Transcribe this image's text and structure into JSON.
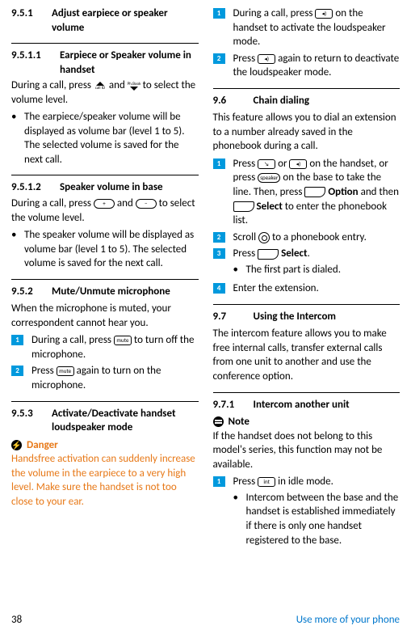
{
  "footer": {
    "page": "38",
    "chapter": "Use more of your phone"
  },
  "left": {
    "s951": {
      "num": "9.5.1",
      "title": "Adjust earpiece or speaker volume"
    },
    "s9511": {
      "num": "9.5.1.1",
      "title": "Earpiece or Speaker volume in handset",
      "p1a": "During a call, press ",
      "p1b": " and ",
      "p1c": " to select the volume level.",
      "bul": "The earpiece/speaker volume will be displayed as volume bar (level 1 to 5). The selected volume is saved for the next call."
    },
    "s9512": {
      "num": "9.5.1.2",
      "title": "Speaker volume in base",
      "p1a": "During a call, press ",
      "p1b": " and ",
      "p1c": " to select the volume level.",
      "keyPlus": "+",
      "keyMinus": "−",
      "bul": "The speaker volume will be displayed as volume bar (level 1 to 5). The selected volume is saved for the next call."
    },
    "s952": {
      "num": "9.5.2",
      "title": "Mute/Unmute microphone",
      "intro": "When the microphone is muted, your correspondent cannot hear you.",
      "step1a": "During a call, press ",
      "step1b": " to turn off the microphone.",
      "step2a": "Press ",
      "step2b": " again to turn on the microphone.",
      "keyMute": "mute"
    },
    "s953": {
      "num": "9.5.3",
      "title": "Activate/Deactivate handset loudspeaker mode",
      "dangerLabel": "Danger",
      "dangerText": "Handsfree activation can suddenly increase the volume in the earpiece to a very high level. Make sure the handset is not too close to your ear."
    }
  },
  "right": {
    "cont": {
      "step1a": "During a call, press ",
      "step1b": " on the handset to activate the loudspeaker mode.",
      "step2a": "Press ",
      "step2b": " again to return to deactivate the loudspeaker mode.",
      "keySpk": "◂)"
    },
    "s96": {
      "num": "9.6",
      "title": "Chain dialing",
      "intro": "This feature allows you to dial an extension to a number already saved in the phonebook during a call.",
      "step1a": "Press ",
      "step1b": " or ",
      "step1c": " on the handset, or press ",
      "step1d": " on the base to take the line. Then, press ",
      "step1Option": "Option",
      "step1e": " and then ",
      "step1Select": "Select",
      "step1f": " to enter the phonebook list.",
      "keyTalk": "↘",
      "keyHFree": "◂)",
      "keySpeaker": "speaker",
      "step2a": "Scroll ",
      "step2b": " to a phonebook entry.",
      "step3a": "Press ",
      "step3Select": "Select",
      "step3b": ".",
      "step3sub": "The first part is dialed.",
      "step4": "Enter the extension."
    },
    "s97": {
      "num": "9.7",
      "title": "Using the Intercom",
      "intro": "The intercom feature allows you to make free internal calls, transfer external calls from one unit to another and use the conference option."
    },
    "s971": {
      "num": "9.7.1",
      "title": "Intercom another unit",
      "noteLabel": "Note",
      "noteText": "If the handset does not belong to this model's series, this function may not be available.",
      "step1a": "Press ",
      "step1b": " in idle mode.",
      "keyInt": "int",
      "step1sub": "Intercom between the base and the handset is established immediately if there is only one handset registered to the base."
    }
  }
}
